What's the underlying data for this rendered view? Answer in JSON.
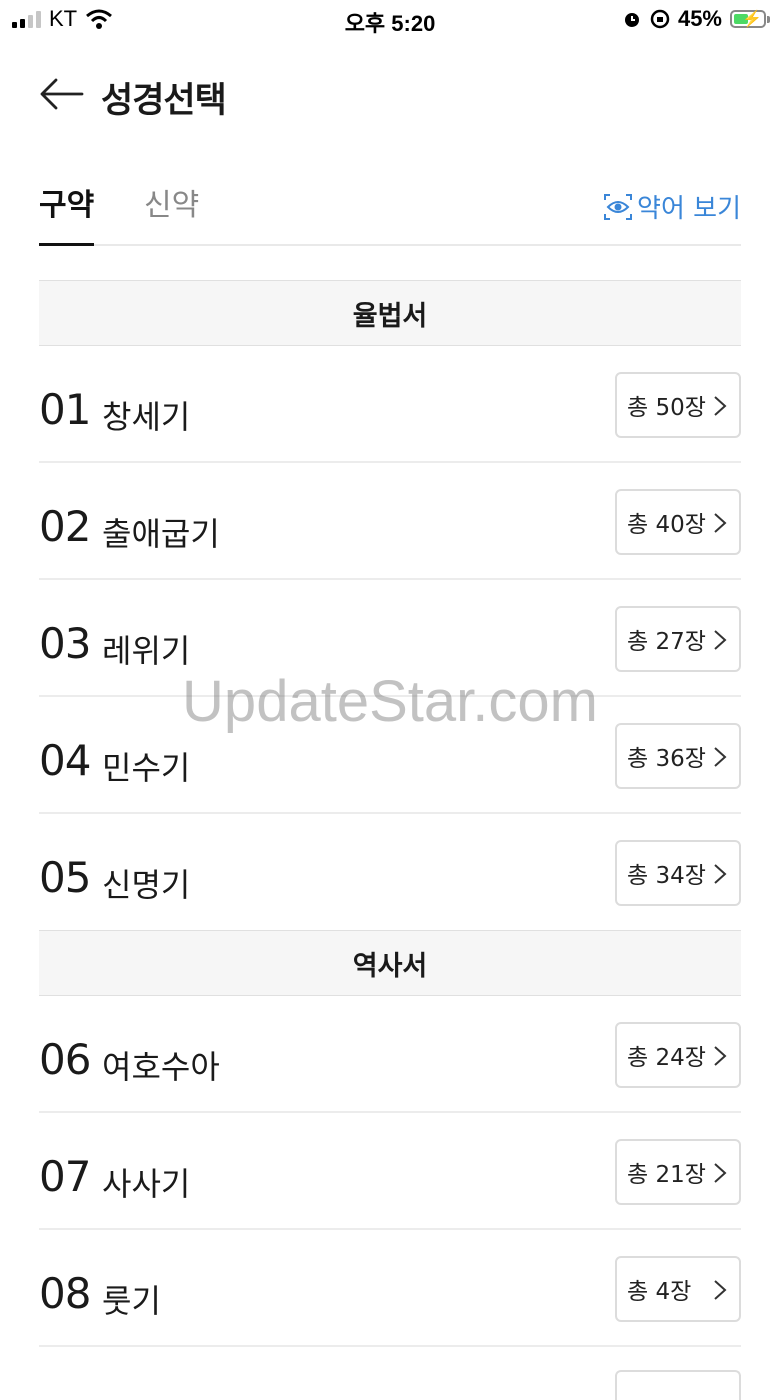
{
  "status_bar": {
    "carrier": "KT",
    "time": "오후 5:20",
    "battery": "45%"
  },
  "header": {
    "title": "성경선택"
  },
  "tabs": {
    "active": "구약",
    "inactive": "신약",
    "abbr_label": "약어 보기"
  },
  "sections": [
    {
      "title": "율법서",
      "books": [
        {
          "num": "01",
          "name": "창세기",
          "chapters": "총 50장"
        },
        {
          "num": "02",
          "name": "출애굽기",
          "chapters": "총 40장"
        },
        {
          "num": "03",
          "name": "레위기",
          "chapters": "총 27장"
        },
        {
          "num": "04",
          "name": "민수기",
          "chapters": "총 36장"
        },
        {
          "num": "05",
          "name": "신명기",
          "chapters": "총 34장"
        }
      ]
    },
    {
      "title": "역사서",
      "books": [
        {
          "num": "06",
          "name": "여호수아",
          "chapters": "총 24장"
        },
        {
          "num": "07",
          "name": "사사기",
          "chapters": "총 21장"
        },
        {
          "num": "08",
          "name": "룻기",
          "chapters": "총 4장"
        }
      ]
    }
  ],
  "watermark": "UpdateStar.com",
  "colors": {
    "accent": "#3a86d8",
    "section_bg": "#f6f6f6"
  }
}
